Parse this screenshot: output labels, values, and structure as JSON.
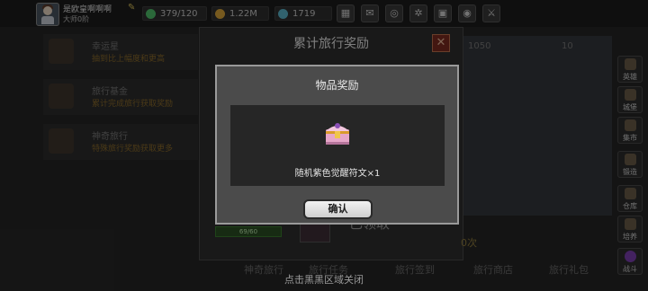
{
  "player": {
    "name": "是欧皇啊啊啊",
    "rank": "大师0阶"
  },
  "resources": {
    "energy": "379/120",
    "gold": "1.22M",
    "gems": "1719"
  },
  "top_icons": [
    "shop-icon",
    "mail-icon",
    "gamepad-icon",
    "gear-icon",
    "gift-icon",
    "color-wheel-icon",
    "sword-icon"
  ],
  "background_panel": {
    "items": [
      {
        "title": "幸运星",
        "subtitle": "抽到比上幅度和更高"
      },
      {
        "title": "旅行基金",
        "subtitle": "累计完成旅行获取奖励"
      },
      {
        "title": "神奇旅行",
        "subtitle": "特殊旅行奖励获取更多"
      }
    ],
    "counts": [
      "1050",
      "10"
    ]
  },
  "side_menu": [
    "英雄",
    "城堡",
    "集市",
    "锻造",
    "仓库",
    "培养",
    "战斗"
  ],
  "outer_dialog": {
    "title": "累计旅行奖励",
    "progress": "69/60",
    "bottom_tabs": [
      "神奇旅行",
      "旅行任务",
      "旅行签到",
      "旅行商店",
      "旅行礼包"
    ],
    "faded_button": "已领取",
    "faded_count": "0次"
  },
  "hint": "点击黑黑区域关闭",
  "modal": {
    "title": "物品奖励",
    "item_icon": "treasure-chest-icon",
    "item_name": "随机紫色觉醒符文×1",
    "confirm_label": "确认"
  },
  "colors": {
    "accent_gold": "#d9c05a",
    "close_red": "#7a2a20",
    "progress_green": "#3a8a2e"
  }
}
